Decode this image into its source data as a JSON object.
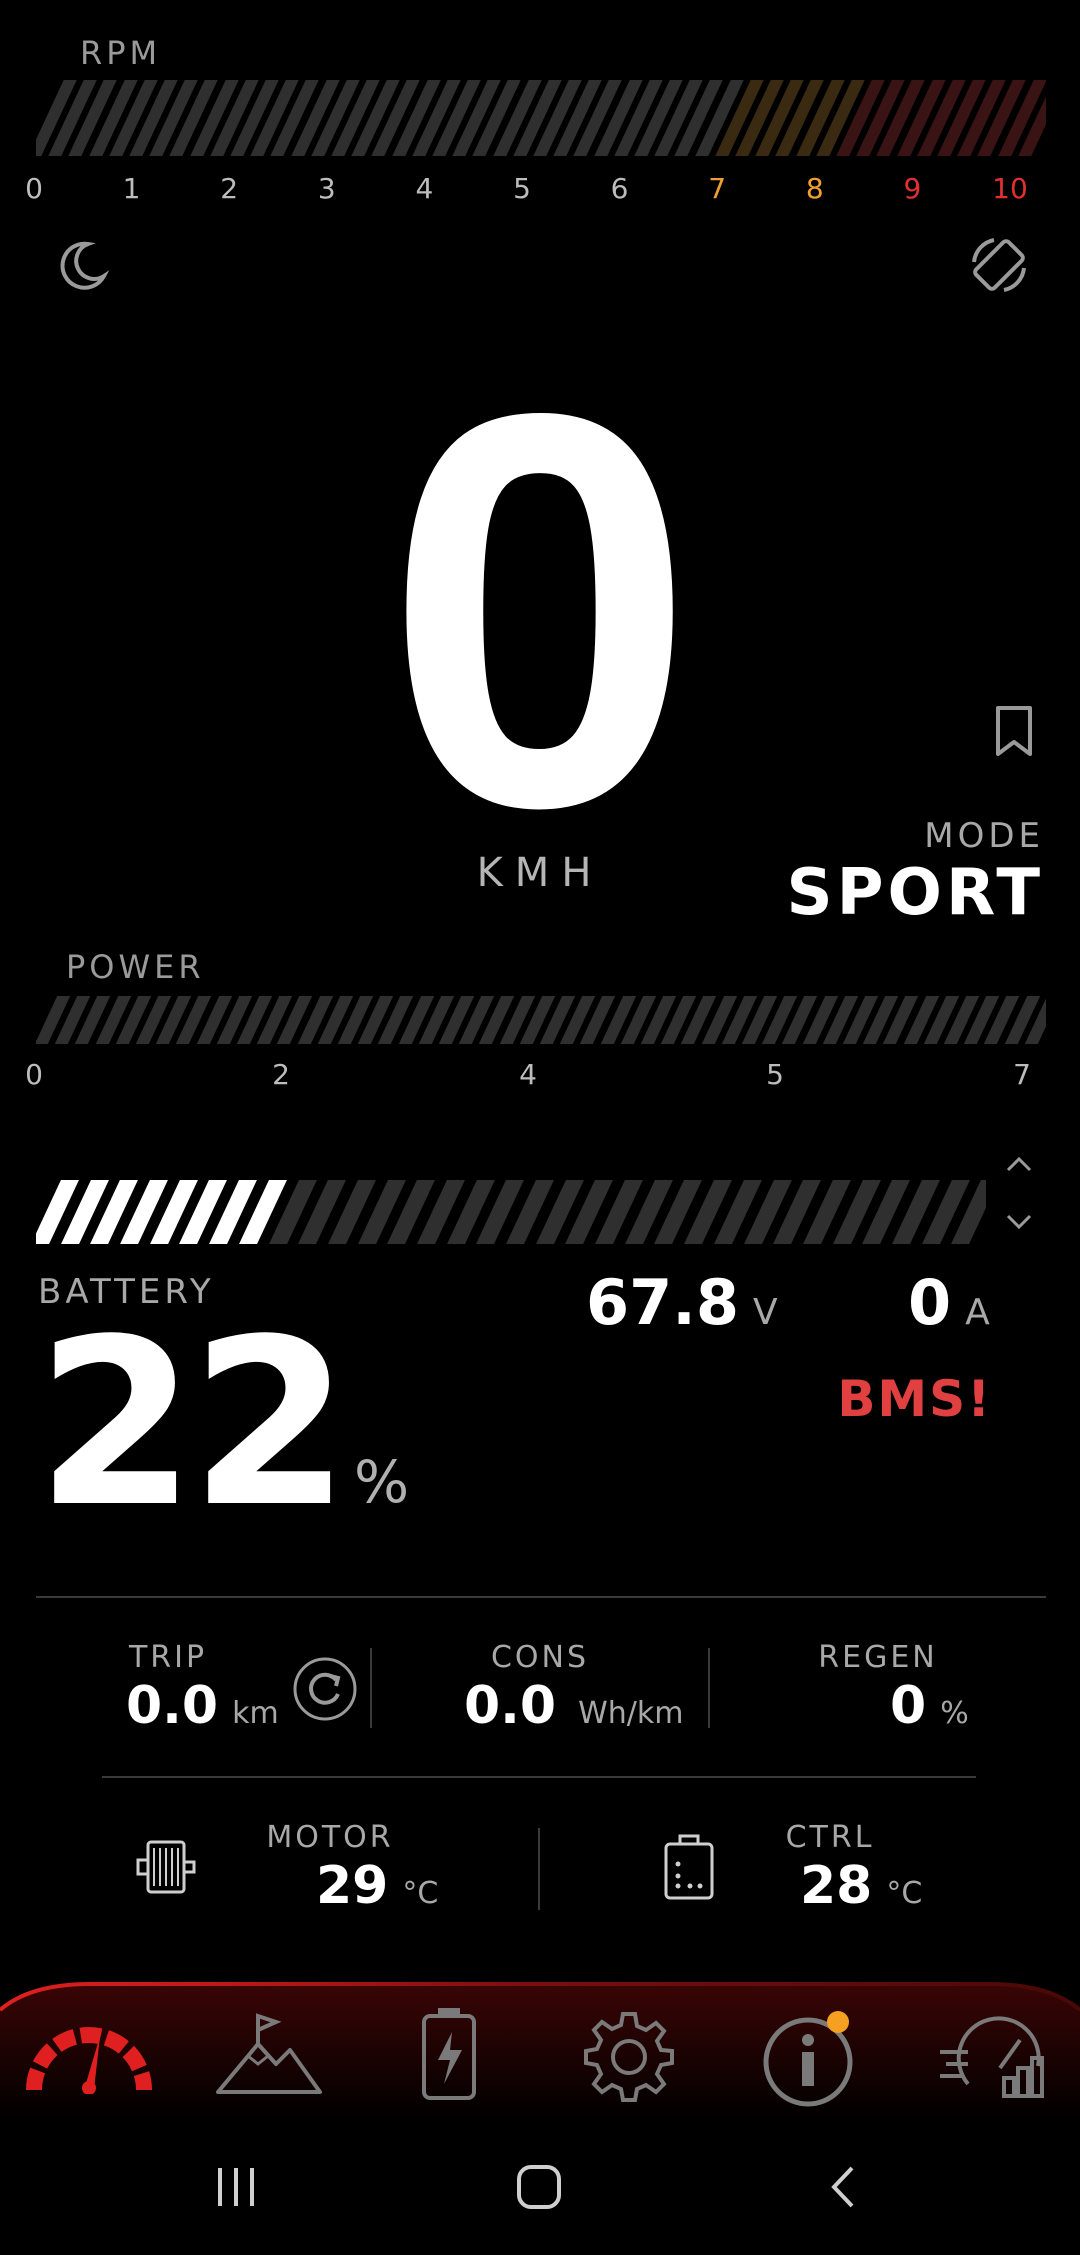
{
  "rpm": {
    "label": "RPM",
    "ticks": [
      "0",
      "1",
      "2",
      "3",
      "4",
      "5",
      "6",
      "7",
      "8",
      "9",
      "10"
    ],
    "tick_colors": [
      "#bdbdbd",
      "#bdbdbd",
      "#bdbdbd",
      "#bdbdbd",
      "#bdbdbd",
      "#bdbdbd",
      "#bdbdbd",
      "#f0a030",
      "#f0a030",
      "#e03030",
      "#e03030"
    ],
    "level": 0
  },
  "speed": {
    "value": "0",
    "unit": "KMH"
  },
  "mode": {
    "label": "MODE",
    "value": "SPORT"
  },
  "power": {
    "label": "POWER",
    "ticks": [
      "0",
      "2",
      "4",
      "5",
      "7"
    ],
    "level": 0
  },
  "battery": {
    "label": "BATTERY",
    "percent": "22",
    "percent_sign": "%",
    "level": 0.22,
    "voltage": "67.8",
    "voltage_unit": "V",
    "current": "0",
    "current_unit": "A",
    "bms_warning": "BMS!"
  },
  "stats": {
    "trip": {
      "label": "TRIP",
      "value": "0.0",
      "unit": "km"
    },
    "cons": {
      "label": "CONS",
      "value": "0.0",
      "unit": "Wh/km"
    },
    "regen": {
      "label": "REGEN",
      "value": "0",
      "unit": "%"
    },
    "motor": {
      "label": "MOTOR",
      "value": "29",
      "unit": "°C"
    },
    "ctrl": {
      "label": "CTRL",
      "value": "28",
      "unit": "°C"
    }
  },
  "colors": {
    "accent_red": "#e02020",
    "warning_red": "#e04040",
    "notification_dot": "#f5a020",
    "tick_inactive": "#3a3a3a"
  },
  "icons": {
    "theme": "moon-icon",
    "rotate": "screen-rotate-icon",
    "bookmark": "bookmark-icon",
    "reset_trip": "refresh-icon",
    "motor": "motor-icon",
    "controller": "controller-icon",
    "nav": [
      "speedometer-icon",
      "mountain-flag-icon",
      "battery-charge-icon",
      "gear-icon",
      "info-icon",
      "gauge-stats-icon"
    ]
  }
}
